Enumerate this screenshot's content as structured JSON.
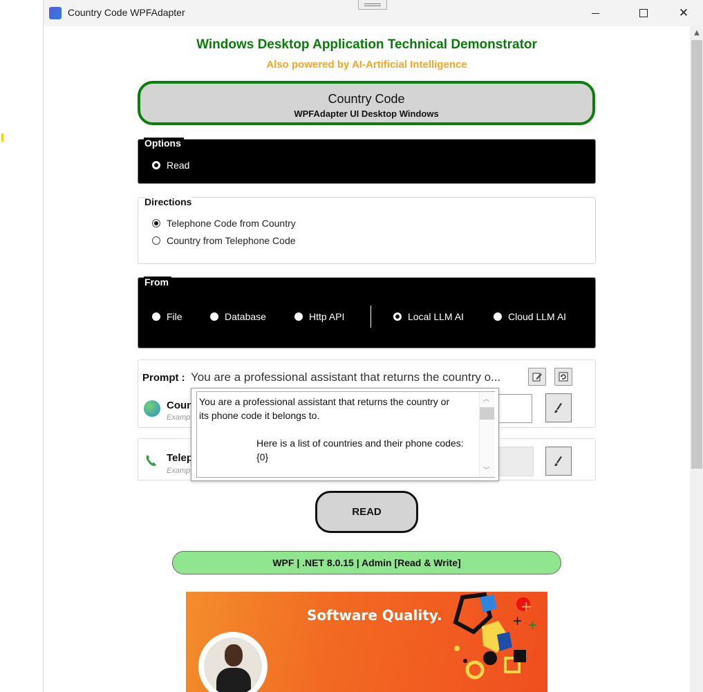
{
  "window": {
    "title": "Country Code WPFAdapter",
    "minimize_icon": "minimize-icon",
    "maximize_icon": "maximize-icon",
    "close_icon": "close-icon"
  },
  "header": {
    "main_title": "Windows Desktop Application Technical Demonstrator",
    "sub_title": "Also powered by AI-Artificial Intelligence",
    "card_title": "Country Code",
    "card_subtitle": "WPFAdapter UI Desktop Windows"
  },
  "options": {
    "legend": "Options",
    "items": [
      {
        "label": "Read",
        "selected": true
      }
    ]
  },
  "directions": {
    "legend": "Directions",
    "items": [
      {
        "label": "Telephone Code from Country",
        "selected": true
      },
      {
        "label": "Country from Telephone Code",
        "selected": false
      }
    ]
  },
  "from": {
    "legend": "From",
    "items": [
      {
        "label": "File",
        "selected": false
      },
      {
        "label": "Database",
        "selected": false
      },
      {
        "label": "Http API",
        "selected": false
      },
      {
        "label": "Local LLM AI",
        "selected": true
      },
      {
        "label": "Cloud LLM AI",
        "selected": false
      }
    ]
  },
  "prompt": {
    "label": "Prompt :",
    "value": "You are a professional assistant that returns the country o...",
    "popup_line1": "You are a professional assistant that returns the country or",
    "popup_line2": "its phone code it belongs to.",
    "popup_line3": "Here is a list of countries and their phone codes:",
    "popup_line4": "{0}"
  },
  "country_row": {
    "label": "Coun",
    "example": "Examp",
    "icon": "globe-icon"
  },
  "telephone_row": {
    "label": "Telep",
    "example": "Examp",
    "icon": "phone-icon"
  },
  "read_button": "READ",
  "status": "WPF | .NET 8.0.15 | Admin [Read & Write]",
  "banner": {
    "text": "Software Quality."
  },
  "colors": {
    "title_green": "#0a7a0a",
    "subtitle_orange": "#f5a623",
    "status_green": "#8fe68f",
    "banner_orange": "#f26a22"
  }
}
